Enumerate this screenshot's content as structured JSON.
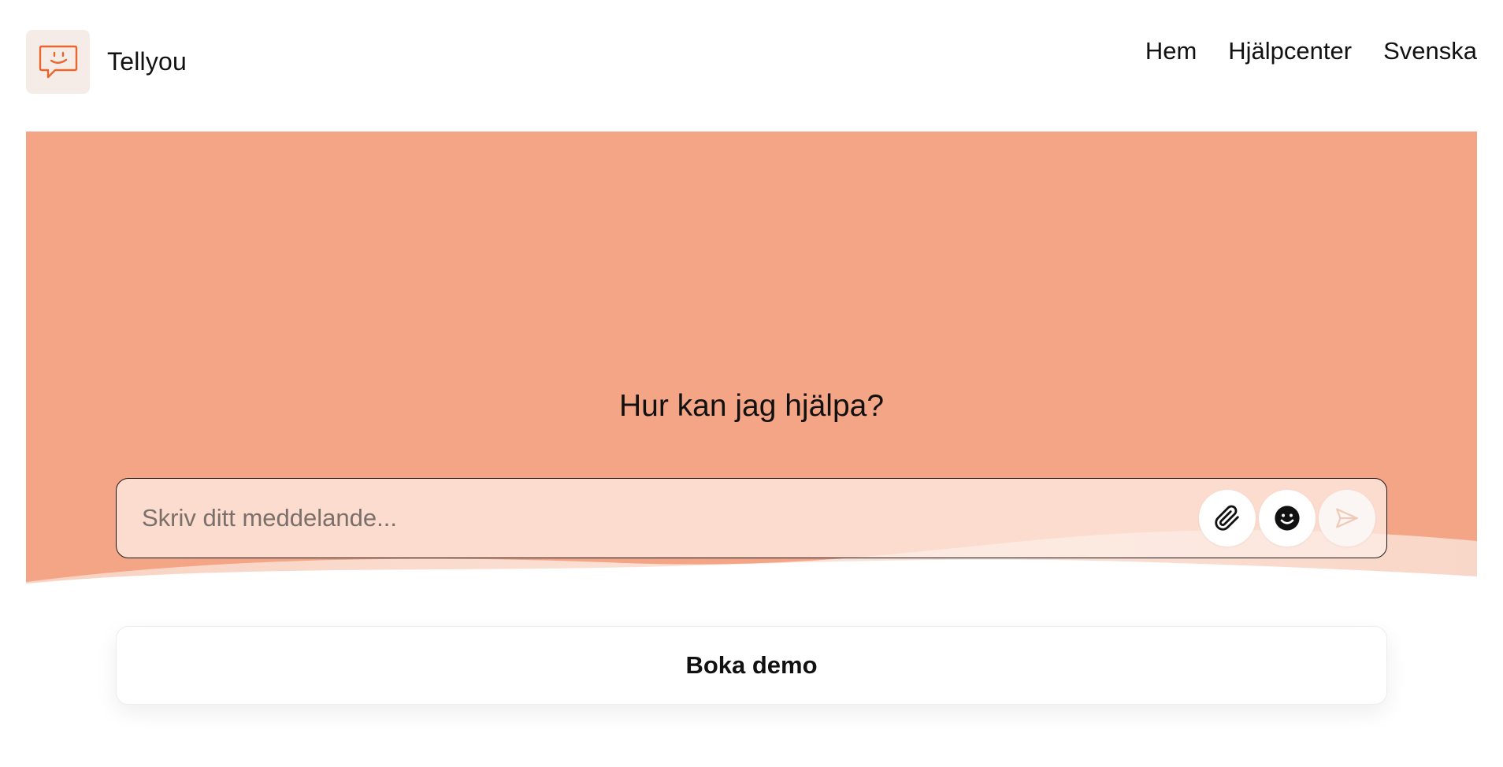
{
  "brand": {
    "name": "Tellyou",
    "logo_icon": "chat-bubble-smile-icon",
    "accent_color": "#e8672d"
  },
  "nav": {
    "items": [
      {
        "label": "Hem"
      },
      {
        "label": "Hjälpcenter"
      },
      {
        "label": "Svenska"
      }
    ]
  },
  "hero": {
    "title": "Hur kan jag hjälpa?",
    "background_color": "#f4a586",
    "wave_color": "#f9d9cb"
  },
  "chat": {
    "placeholder": "Skriv ditt meddelande...",
    "value": "",
    "buttons": [
      {
        "icon": "paperclip-icon"
      },
      {
        "icon": "smiley-icon"
      },
      {
        "icon": "send-icon"
      }
    ]
  },
  "demo": {
    "label": "Boka demo"
  }
}
